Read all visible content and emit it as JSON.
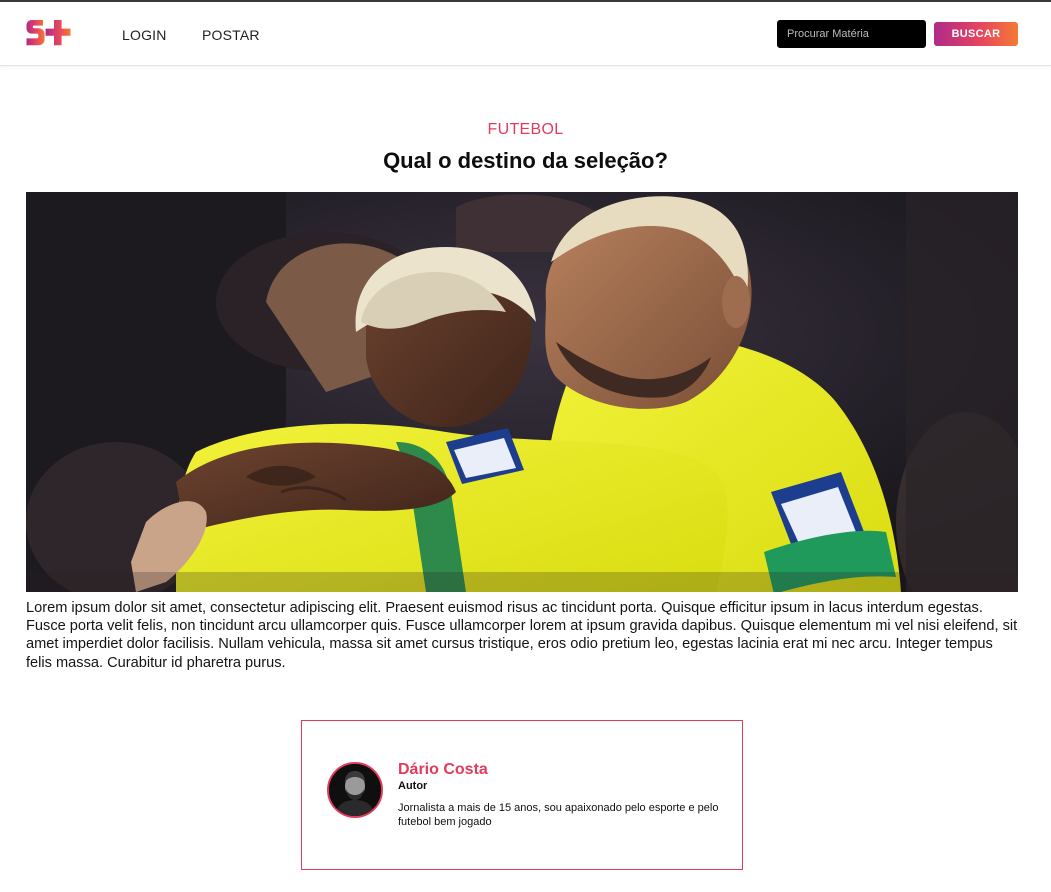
{
  "brand": {
    "logo_alt": "S+",
    "colors": {
      "accent": "#e23c5c",
      "gradient_start": "#b02a8a",
      "gradient_end": "#f47a34"
    }
  },
  "nav": {
    "links": [
      {
        "label": "LOGIN"
      },
      {
        "label": "POSTAR"
      }
    ],
    "search": {
      "placeholder": "Procurar Matéria",
      "value": "",
      "button_label": "BUSCAR"
    }
  },
  "article": {
    "category": "FUTEBOL",
    "title": "Qual o destino da seleção?",
    "image_alt": "Jogadores da seleção brasileira se abraçando",
    "body": "Lorem ipsum dolor sit amet, consectetur adipiscing elit. Praesent euismod risus ac tincidunt porta. Quisque efficitur ipsum in lacus interdum egestas. Fusce porta velit felis, non tincidunt arcu ullamcorper quis. Fusce ullamcorper lorem at ipsum gravida dapibus. Quisque elementum mi vel nisi eleifend, sit amet imperdiet dolor facilisis. Nullam vehicula, massa sit amet cursus tristique, eros odio pretium leo, egestas lacinia erat mi nec arcu. Integer tempus felis massa. Curabitur id pharetra purus."
  },
  "author": {
    "name": "Dário Costa",
    "role": "Autor",
    "bio": "Jornalista a mais de 15 anos, sou apaixonado pelo esporte e pelo futebol bem jogado"
  }
}
